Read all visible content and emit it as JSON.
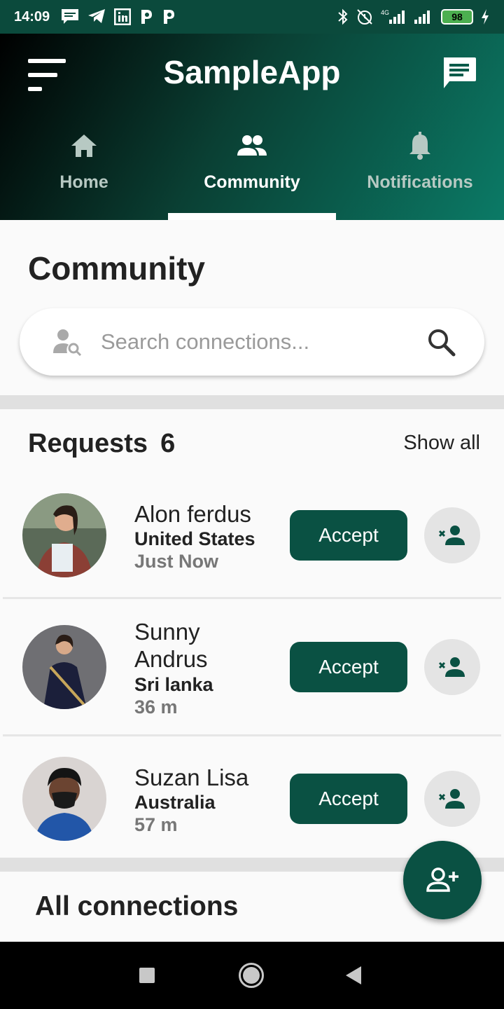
{
  "status_bar": {
    "time": "14:09",
    "left_icons": [
      "message-icon",
      "telegram-icon",
      "linkedin-icon",
      "p-icon",
      "p-icon"
    ],
    "right_icons": [
      "bluetooth-icon",
      "alarm-off-icon",
      "signal-4g-icon",
      "signal-icon"
    ],
    "network_label": "4G",
    "battery": "98"
  },
  "header": {
    "title": "SampleApp",
    "menu_icon": "menu-icon",
    "chat_icon": "chat-icon"
  },
  "tabs": [
    {
      "label": "Home",
      "icon": "home-icon",
      "active": false
    },
    {
      "label": "Community",
      "icon": "people-icon",
      "active": true
    },
    {
      "label": "Notifications",
      "icon": "bell-icon",
      "active": false
    }
  ],
  "page": {
    "title": "Community"
  },
  "search": {
    "placeholder": "Search connections...",
    "value": ""
  },
  "requests": {
    "title": "Requests",
    "count": "6",
    "show_all": "Show all",
    "items": [
      {
        "name": "Alon ferdus",
        "country": "United States",
        "time": "Just Now",
        "accept": "Accept"
      },
      {
        "name": "Sunny Andrus",
        "country": "Sri lanka",
        "time": "36 m",
        "accept": "Accept"
      },
      {
        "name": "Suzan Lisa",
        "country": "Australia",
        "time": "57 m",
        "accept": "Accept"
      }
    ]
  },
  "connections": {
    "title": "All connections"
  },
  "colors": {
    "primary": "#0a5143",
    "header_start": "#000000",
    "header_end": "#0b7a66",
    "background": "#fafafa"
  }
}
